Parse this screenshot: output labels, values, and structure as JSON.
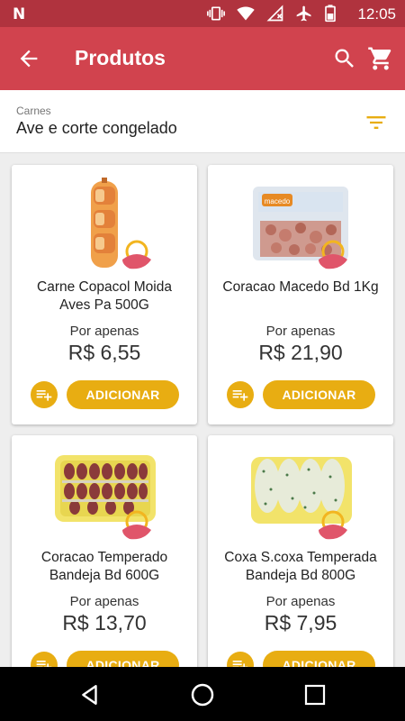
{
  "status_bar": {
    "time": "12:05",
    "left_icon": "notification-n-icon",
    "icons": [
      "vibrate-icon",
      "wifi-icon",
      "no-signal-icon",
      "airplane-icon",
      "battery-icon"
    ]
  },
  "app_bar": {
    "title": "Produtos",
    "back_icon": "arrow-back-icon",
    "search_icon": "search-icon",
    "cart_icon": "cart-icon"
  },
  "filter": {
    "category": "Carnes",
    "subcategory": "Ave e corte congelado",
    "filter_icon": "filter-list-icon"
  },
  "products": [
    {
      "name": "Carne Copacol Moida Aves Pa 500G",
      "price_prefix": "Por apenas",
      "price": "R$ 6,55",
      "add_label": "ADICIONAR",
      "image": "ground-chicken-package-image"
    },
    {
      "name": "Coracao Macedo Bd 1Kg",
      "price_prefix": "Por apenas",
      "price": "R$ 21,90",
      "add_label": "ADICIONAR",
      "image": "chicken-hearts-tray-image",
      "brand_on_pack": "macedo"
    },
    {
      "name": "Coracao Temperado Bandeja Bd 600G",
      "price_prefix": "Por apenas",
      "price": "R$ 13,70",
      "add_label": "ADICIONAR",
      "image": "seasoned-hearts-skewers-image"
    },
    {
      "name": "Coxa S.coxa Temperada Bandeja Bd 800G",
      "price_prefix": "Por apenas",
      "price": "R$ 7,95",
      "add_label": "ADICIONAR",
      "image": "seasoned-drumsticks-tray-image"
    }
  ],
  "colors": {
    "status_bar": "#b0333e",
    "app_bar": "#d1434e",
    "accent": "#e8ad12",
    "badge_pink": "#e0556a",
    "background": "#eeeeee"
  },
  "nav_bar": {
    "back": "nav-back-icon",
    "home": "nav-home-icon",
    "recents": "nav-recents-icon"
  }
}
